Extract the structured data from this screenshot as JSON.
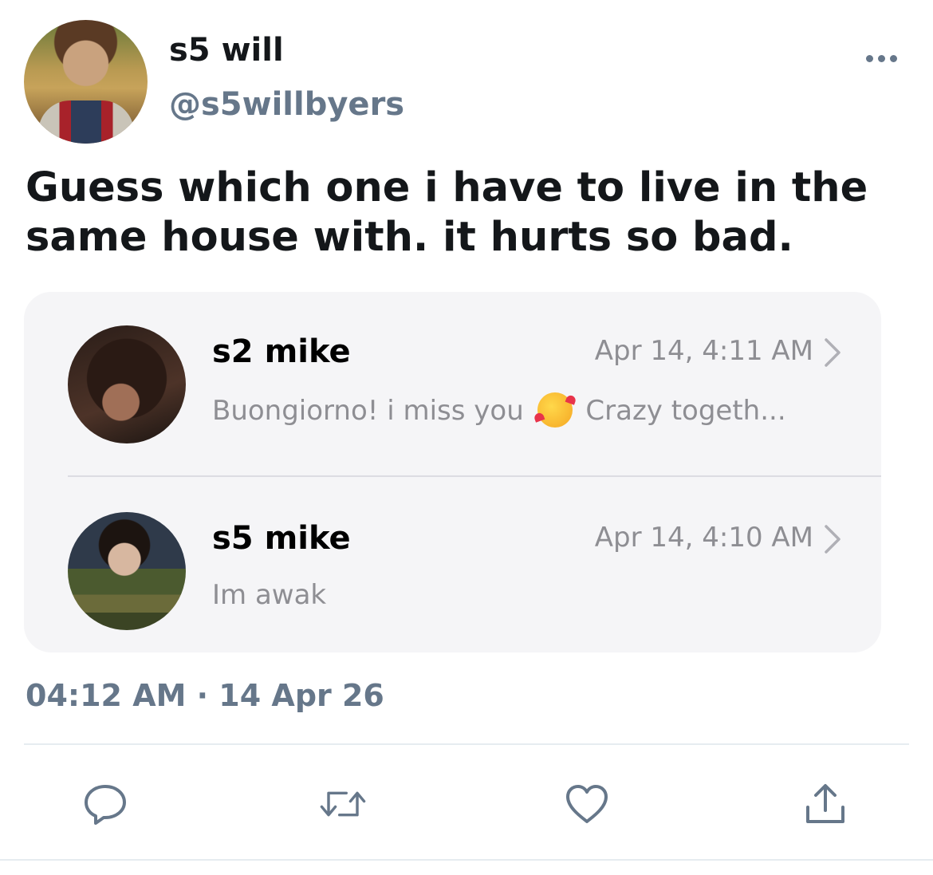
{
  "author": {
    "display_name": "s5 will",
    "handle": "@s5willbyers"
  },
  "tweet_text": "Guess which one i have to live in the same house with. it hurts so bad.",
  "embedded_messages": [
    {
      "name": "s2 mike",
      "time": "Apr 14, 4:11 AM",
      "preview_before": "Buongiorno! i miss you",
      "preview_emoji": "smiling-face-with-hearts-emoji",
      "preview_after": "Crazy togeth..."
    },
    {
      "name": "s5 mike",
      "time": "Apr 14, 4:10 AM",
      "preview": "Im awak"
    }
  ],
  "timestamp": "04:12 AM · 14 Apr 26",
  "actions": [
    "reply-icon",
    "retweet-icon",
    "like-icon",
    "share-icon"
  ],
  "colors": {
    "text": "#14171a",
    "secondary": "#66778a",
    "card_bg": "#f5f5f7",
    "preview_gray": "#8e8e93"
  }
}
